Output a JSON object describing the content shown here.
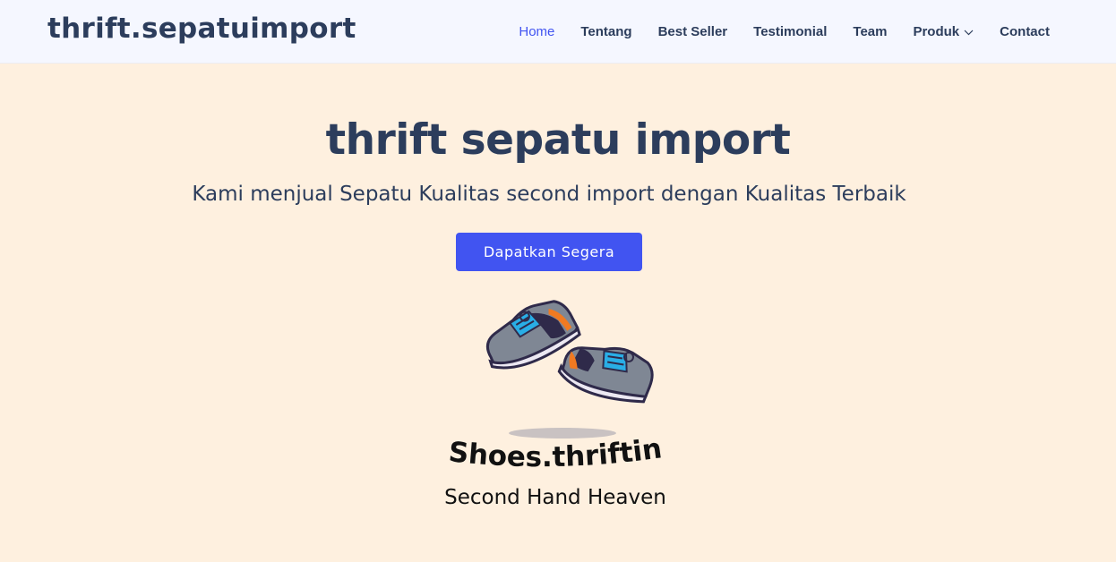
{
  "header": {
    "logo": "thrift.sepatuimport",
    "nav": [
      {
        "label": "Home",
        "active": true
      },
      {
        "label": "Tentang"
      },
      {
        "label": "Best Seller"
      },
      {
        "label": "Testimonial"
      },
      {
        "label": "Team"
      },
      {
        "label": "Produk",
        "has_dropdown": true,
        "icon": "chevron-down-icon"
      },
      {
        "label": "Contact"
      }
    ]
  },
  "hero": {
    "title": "thrift sepatu import",
    "subtitle": "Kami menjual Sepatu Kualitas second import dengan Kualitas Terbaik",
    "cta_label": "Dapatkan Segera",
    "brand_text": "Shoes.thrifting",
    "tagline": "Second Hand Heaven"
  },
  "colors": {
    "accent": "#4154f1",
    "text": "#2c3d5c",
    "hero_bg": "#fef0df",
    "nav_bg": "#f5f7ff"
  }
}
